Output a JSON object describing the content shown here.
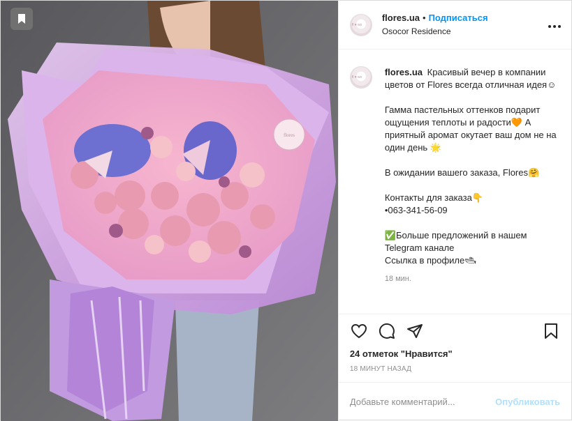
{
  "post": {
    "username": "flores.ua",
    "dot": "•",
    "follow_label": "Подписаться",
    "location": "Osocor Residence",
    "more_label": "•••"
  },
  "caption": {
    "username": "flores.ua",
    "line1": "Красивый вечер в компании цветов от Flores всегда отличная идея☺",
    "line2": "Гамма пастельных оттенков подарит ощущения теплоты и радости🧡 А приятный аромат окутает ваш дом не на один день 🌟",
    "line3": "В ожидании вашего заказа, Flores🤗",
    "line4": "Контакты для заказа👇",
    "line5": "•063-341-56-09",
    "line6": "✅Больше предложений в нашем Telegram канале",
    "line7": "Ссылка в профиле🛥",
    "time": "18 мин."
  },
  "likes": "24 отметок \"Нравится\"",
  "timestamp": "18 МИНУТ НАЗАД",
  "comment": {
    "placeholder": "Добавьте комментарий...",
    "publish_label": "Опубликовать"
  },
  "icons": {
    "like": "heart-icon",
    "comment": "comment-icon",
    "share": "share-icon",
    "save": "bookmark-icon"
  },
  "colors": {
    "link": "#0095f6",
    "publish_disabled": "#b2dffc",
    "muted": "#8e8e8e"
  }
}
